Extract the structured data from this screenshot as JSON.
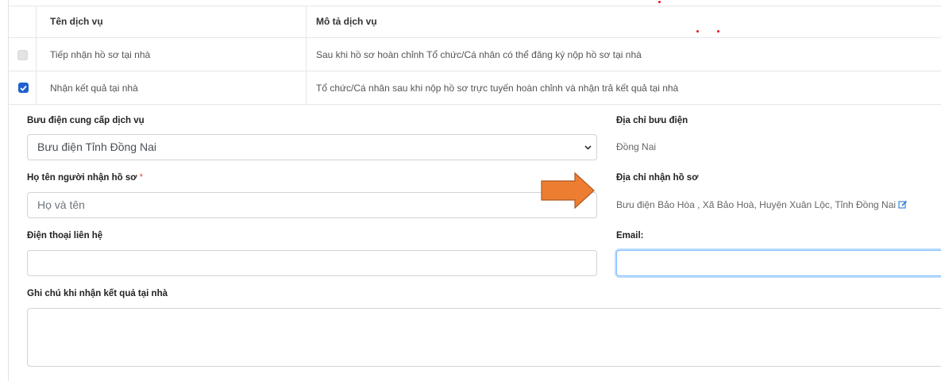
{
  "table": {
    "headers": {
      "name": "Tên dịch vụ",
      "desc": "Mô tả dịch vụ"
    },
    "rows": [
      {
        "name": "Tiếp nhận hồ sơ tại nhà",
        "desc": "Sau khi hồ sơ hoàn chỉnh Tổ chức/Cá nhân có thể đăng ký nộp hồ sơ tại nhà",
        "checked": false
      },
      {
        "name": "Nhận kết quả tại nhà",
        "desc": "Tổ chức/Cá nhân sau khi nộp hồ sơ trực tuyến hoàn chỉnh và nhận trả kết quả tại nhà",
        "checked": true
      }
    ]
  },
  "form": {
    "post_office_label": "Bưu điện cung cấp dịch vụ",
    "post_office_value": "Bưu điện Tỉnh Đồng Nai",
    "post_address_label": "Địa chỉ bưu điện",
    "post_address_value": "Đồng Nai",
    "recipient_label": "Họ tên người nhận hồ sơ",
    "required_mark": "*",
    "recipient_placeholder": "Họ và tên",
    "receive_address_label": "Địa chỉ nhận hồ sơ",
    "receive_address_value": "Bưu điện Bảo Hòa , Xã Bảo Hoà, Huyện Xuân Lộc, Tỉnh Đồng Nai",
    "phone_label": "Điện thoại liên hệ",
    "phone_value": "",
    "email_label": "Email:",
    "email_value": "",
    "note_label": "Ghi chú khi nhận kết quả tại nhà",
    "note_value": ""
  },
  "colors": {
    "arrow": "#ed7d31",
    "arrow_border": "#ae5a21",
    "checkbox": "#1f5fd1",
    "focus": "#80bdff"
  }
}
